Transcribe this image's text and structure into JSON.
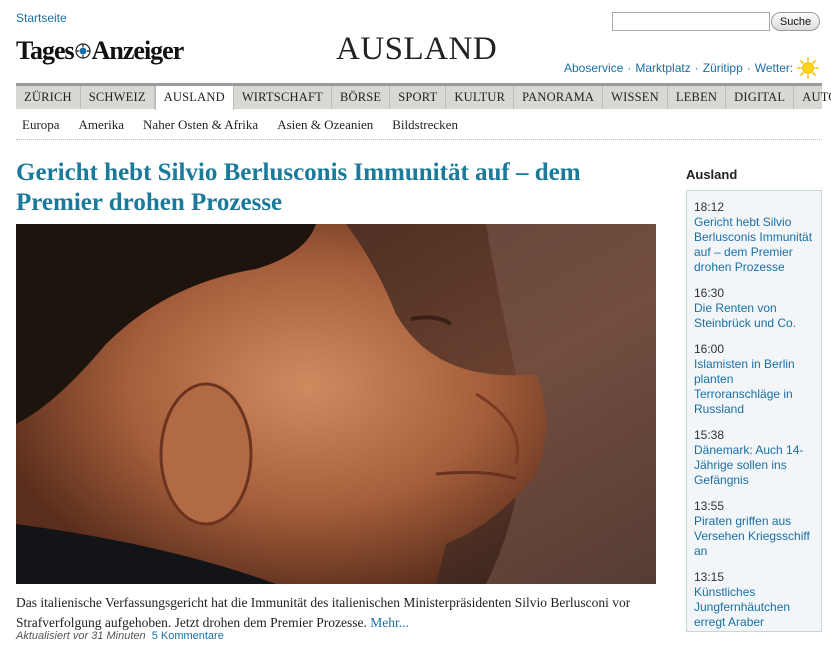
{
  "header": {
    "home_link": "Startseite",
    "search_placeholder": "",
    "search_button": "Suche",
    "logo_text_left": "Tages",
    "logo_text_right": "Anzeiger",
    "section_title": "AUSLAND",
    "service_links": [
      "Aboservice",
      "Marktplatz",
      "Züritipp",
      "Wetter:"
    ],
    "weather_icon": "sun-icon"
  },
  "main_nav": {
    "items": [
      "ZÜRICH",
      "SCHWEIZ",
      "AUSLAND",
      "WIRTSCHAFT",
      "BÖRSE",
      "SPORT",
      "KULTUR",
      "PANORAMA",
      "WISSEN",
      "LEBEN",
      "DIGITAL",
      "AUTO"
    ],
    "active": "AUSLAND"
  },
  "sub_nav": {
    "items": [
      "Europa",
      "Amerika",
      "Naher Osten & Afrika",
      "Asien & Ozeanien",
      "Bildstrecken"
    ]
  },
  "article": {
    "headline": "Gericht hebt Silvio Berlusconis Immunität auf – dem Premier drohen Prozesse",
    "lead": "Das italienische Verfassungsgericht hat die Immunität des italienischen Ministerpräsidenten Silvio Berlusconi vor Strafverfolgung aufgehoben. Jetzt drohen dem Premier Prozesse.",
    "more_link": "Mehr...",
    "updated": "Aktualisiert vor 31 Minuten",
    "comments": "5 Kommentare"
  },
  "sidebar": {
    "title": "Ausland",
    "news": [
      {
        "time": "18:12",
        "title": "Gericht hebt Silvio Berlusconis Immunität auf – dem Premier drohen Prozesse"
      },
      {
        "time": "16:30",
        "title": "Die Renten von Steinbrück und Co."
      },
      {
        "time": "16:00",
        "title": "Islamisten in Berlin planten Terroranschläge in Russland"
      },
      {
        "time": "15:38",
        "title": "Dänemark: Auch 14-Jährige sollen ins Gefängnis"
      },
      {
        "time": "13:55",
        "title": "Piraten griffen aus Versehen Kriegsschiff an"
      },
      {
        "time": "13:15",
        "title": "Künstliches Jungfernhäutchen erregt Araber"
      }
    ]
  },
  "colors": {
    "link": "#1a6fa6",
    "headline": "#1a7a9c",
    "nav_bg": "#d8d8d4"
  }
}
